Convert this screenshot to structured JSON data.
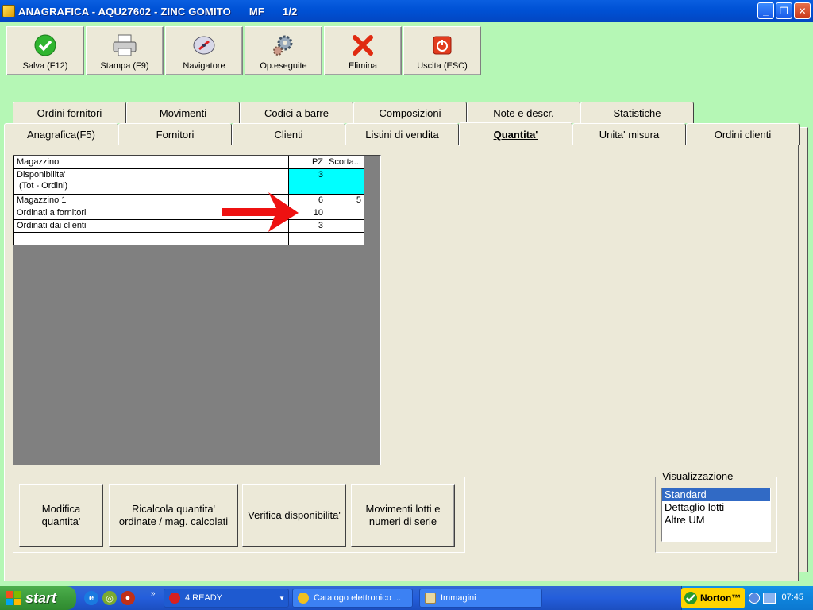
{
  "window": {
    "title": "ANAGRAFICA - AQU27602 - ZINC GOMITO      MF      1/2"
  },
  "toolbar": [
    {
      "label": "Salva (F12)",
      "icon": "check-icon"
    },
    {
      "label": "Stampa (F9)",
      "icon": "printer-icon"
    },
    {
      "label": "Navigatore",
      "icon": "compass-icon"
    },
    {
      "label": "Op.eseguite",
      "icon": "gears-icon"
    },
    {
      "label": "Elimina",
      "icon": "delete-x-icon"
    },
    {
      "label": "Uscita (ESC)",
      "icon": "power-icon"
    }
  ],
  "tabs_back": [
    "Ordini fornitori",
    "Movimenti",
    "Codici a barre",
    "Composizioni",
    "Note e descr.",
    "Statistiche"
  ],
  "tabs_front": [
    "Anagrafica(F5)",
    "Fornitori",
    "Clienti",
    "Listini di vendita",
    "Quantita'",
    "Unita' misura",
    "Ordini clienti"
  ],
  "active_tab": "Quantita'",
  "grid": {
    "headers": [
      "Magazzino",
      "PZ",
      "Scorta..."
    ],
    "rows": [
      {
        "label_line1": "Disponibilita'",
        "label_line2": " (Tot - Ordini)",
        "pz": "3",
        "scorta": ""
      },
      {
        "label": "Magazzino 1",
        "pz": "6",
        "scorta": "5"
      },
      {
        "label": "Ordinati a fornitori",
        "pz": "10",
        "scorta": ""
      },
      {
        "label": "Ordinati dai clienti",
        "pz": "3",
        "scorta": ""
      },
      {
        "label": "",
        "pz": "",
        "scorta": ""
      }
    ],
    "highlight_color": "#00ffff"
  },
  "annotation": {
    "arrow_color": "#ee1111"
  },
  "actions": [
    {
      "line1": "Modifica",
      "line2": "quantita'"
    },
    {
      "line1": "Ricalcola quantita'",
      "line2": "ordinate / mag. calcolati"
    },
    {
      "line1": "Verifica disponibilita'",
      "line2": ""
    },
    {
      "line1": "Movimenti lotti e",
      "line2": "numeri di serie"
    }
  ],
  "visualizzazione": {
    "title": "Visualizzazione",
    "options": [
      "Standard",
      "Dettaglio lotti",
      "Altre UM"
    ],
    "selected": "Standard"
  },
  "taskbar": {
    "start_label": "start",
    "tasks": [
      "4 READY",
      "Catalogo elettronico ...",
      "Immagini"
    ],
    "norton_label": "Norton™",
    "clock": "07:45"
  }
}
